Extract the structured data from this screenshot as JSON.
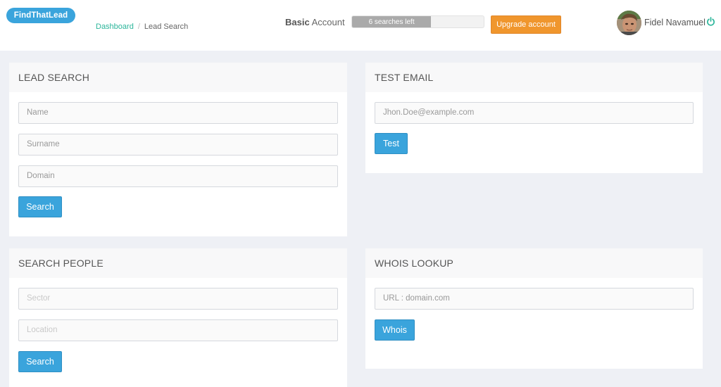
{
  "app": {
    "logo": "FindThatLead"
  },
  "breadcrumb": {
    "link": "Dashboard",
    "separator": "/",
    "current": "Lead Search"
  },
  "account": {
    "plan": "Basic",
    "label": "Account",
    "searches_left": "6 searches left",
    "searches_fraction": 0.6,
    "upgrade_label": "Upgrade account"
  },
  "user": {
    "name": "Fidel Navamuel",
    "logout_icon": "power-icon"
  },
  "lead_search": {
    "title": "LEAD SEARCH",
    "name_placeholder": "Name",
    "surname_placeholder": "Surname",
    "domain_placeholder": "Domain",
    "button": "Search"
  },
  "test_email": {
    "title": "TEST EMAIL",
    "email_placeholder": "Jhon.Doe@example.com",
    "button": "Test"
  },
  "search_people": {
    "title": "SEARCH PEOPLE",
    "sector_placeholder": "Sector",
    "location_placeholder": "Location",
    "button": "Search"
  },
  "whois": {
    "title": "WHOIS LOOKUP",
    "url_placeholder": "URL : domain.com",
    "button": "Whois"
  },
  "colors": {
    "accent": "#3aa4dc",
    "breadcrumb_link": "#2bb59a",
    "upgrade": "#f0962d",
    "background": "#eef0f5"
  }
}
